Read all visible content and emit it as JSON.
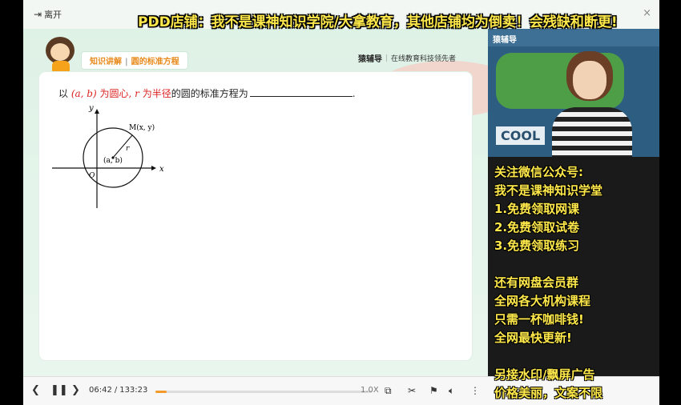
{
  "topbar": {
    "leave_label": "离开",
    "close_glyph": "×"
  },
  "banner_text": "PDD店铺：我不是课神知识学院/大拿教育，其他店铺均为倒卖！会残缺和断更!",
  "slide": {
    "topic_left": "知识讲解",
    "topic_right": "圆的标准方程",
    "brand_logo": "猿辅导",
    "brand_tagline": "在线教育科技领先者",
    "question": {
      "prefix": "以",
      "center": "(a, b)",
      "mid1": "为圆心,",
      "r": "r",
      "mid2": "为半径",
      "suffix": "的圆的标准方程为",
      "end": "."
    },
    "diagram": {
      "y_label": "y",
      "x_label": "x",
      "origin_label": "O",
      "point_label": "M(x, y)",
      "center_label": "(a, b)",
      "radius_label": "r"
    }
  },
  "player": {
    "current_time": "06:42",
    "separator": "/",
    "total_time": "133:23",
    "progress": 0.05,
    "rate": "1.0X",
    "accent": "#f39a2a"
  },
  "webcam": {
    "logo": "猿辅导",
    "sign": "COOL"
  },
  "ad_lines": [
    "关注微信公众号:",
    "我不是课神知识学堂",
    "1.免费领取网课",
    "2.免费领取试卷",
    "3.免费领取练习",
    "",
    "还有网盘会员群",
    "全网各大机构课程",
    "只需一杯咖啡钱!",
    "全网最快更新!",
    "",
    "另接水印/飘屏广告",
    "价格美丽，文案不限"
  ],
  "colors": {
    "banner_text": "#ffe94a",
    "topic_text": "#e98a1c",
    "highlight_red": "#d22222"
  }
}
